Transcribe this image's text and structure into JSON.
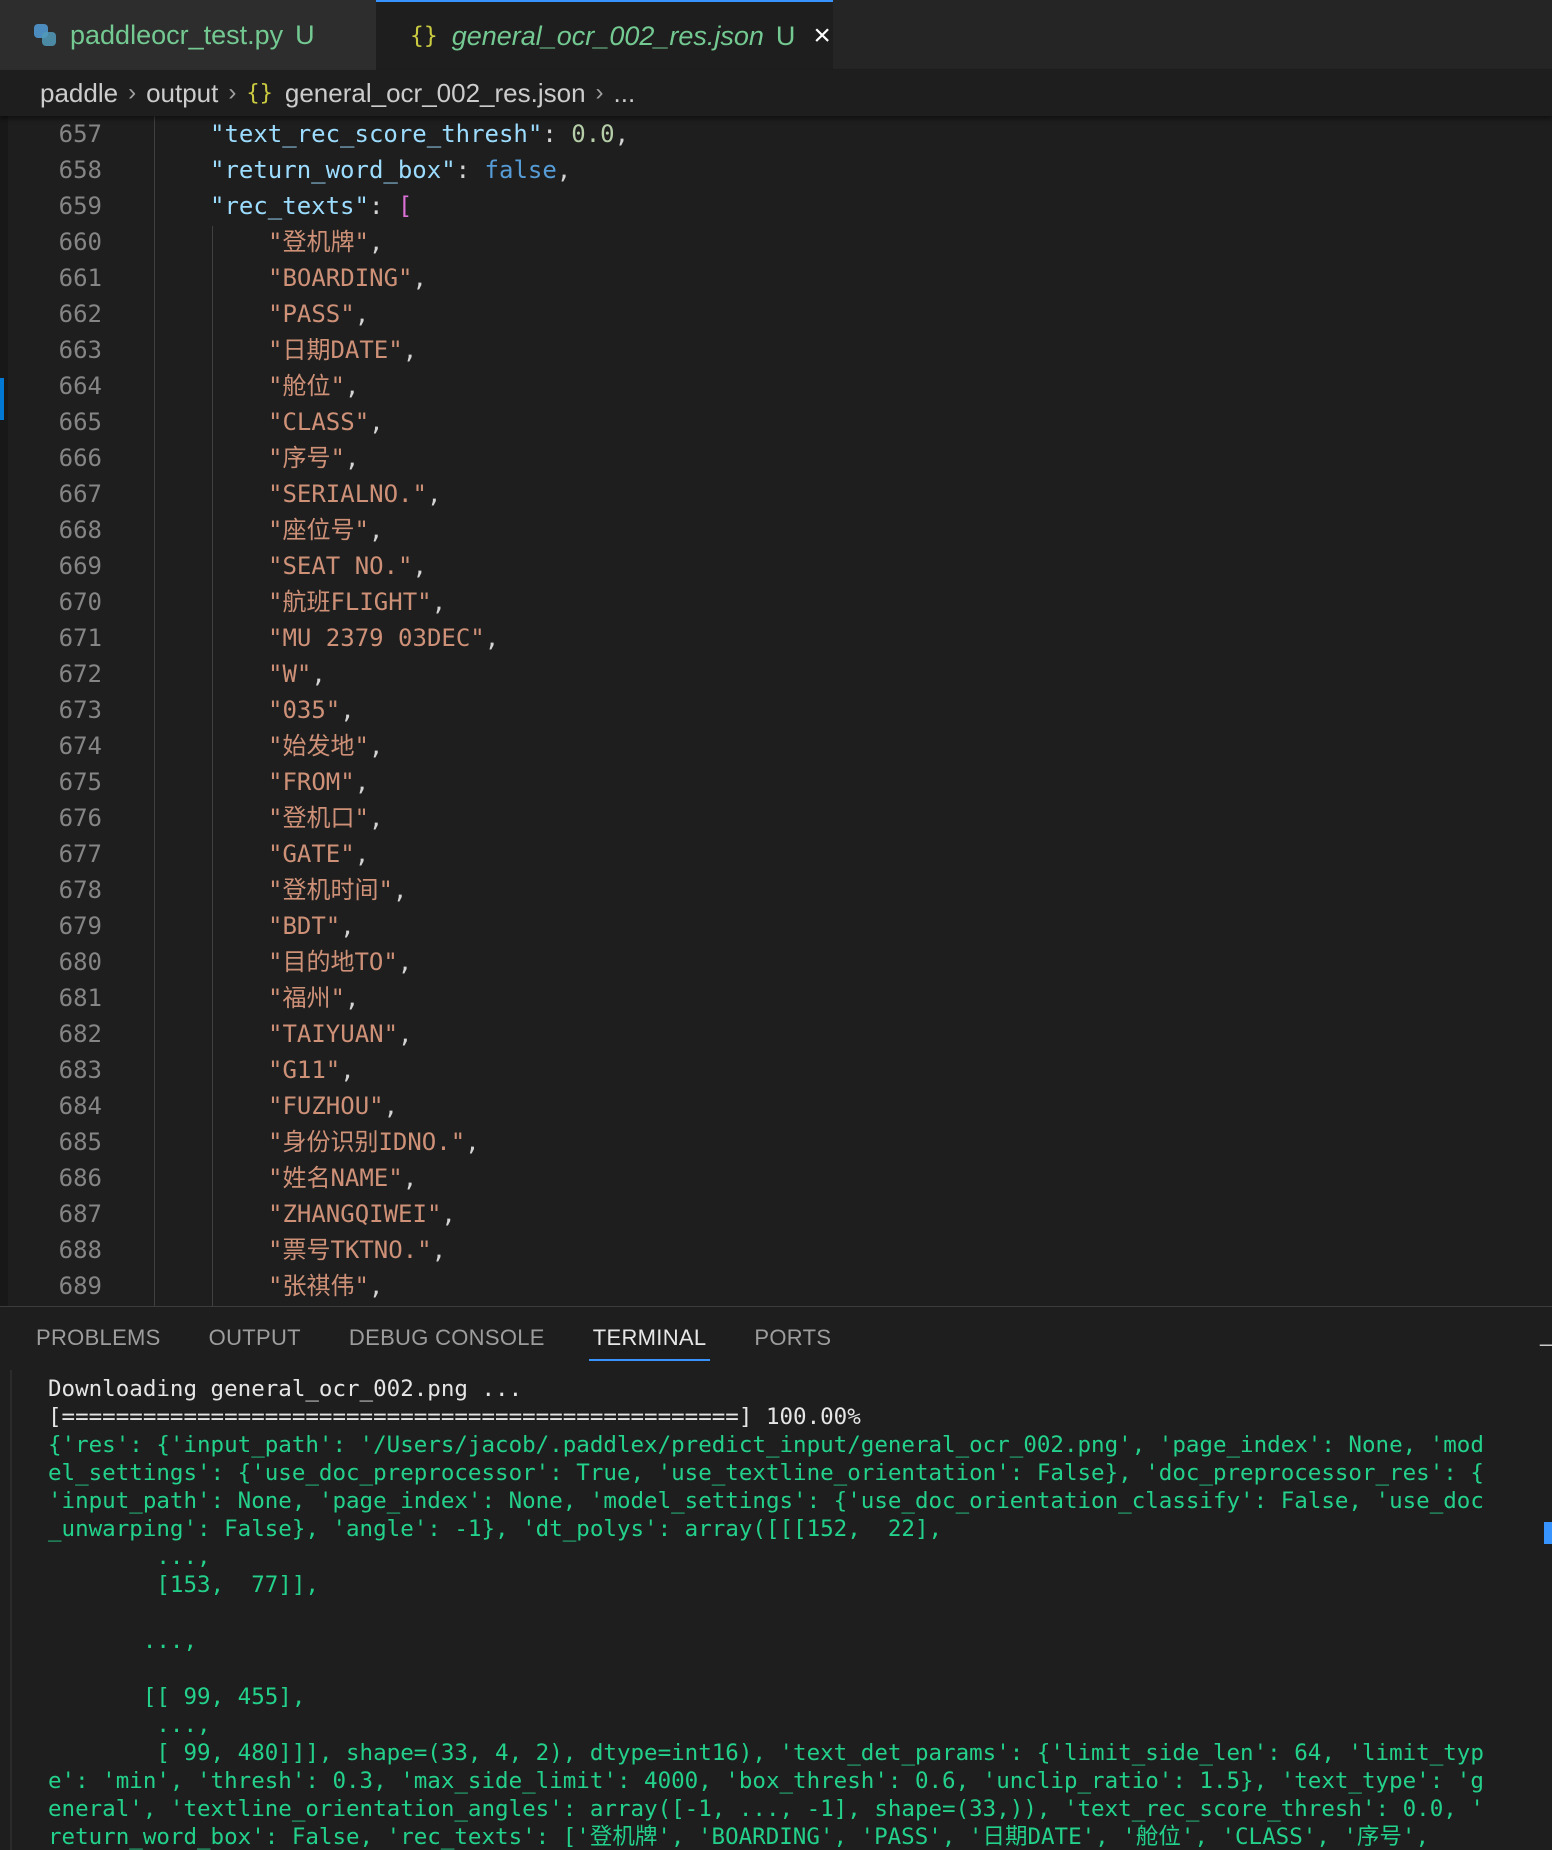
{
  "tabs": [
    {
      "label": "paddleocr_test.py",
      "status": "U",
      "icon": "python-file-icon",
      "active": false
    },
    {
      "label": "general_ocr_002_res.json",
      "status": "U",
      "icon": "json-file-icon",
      "active": true,
      "close": "×"
    }
  ],
  "breadcrumb": {
    "items": [
      "paddle",
      "output",
      "general_ocr_002_res.json",
      "..."
    ],
    "json_glyph": "{}",
    "separator": "›"
  },
  "editor": {
    "lines": [
      {
        "num": "657",
        "key": "\"text_rec_score_thresh\"",
        "colon": ": ",
        "value": "0.0",
        "vtype": "number",
        "tail": ","
      },
      {
        "num": "658",
        "key": "\"return_word_box\"",
        "colon": ": ",
        "value": "false",
        "vtype": "bool",
        "tail": ","
      },
      {
        "num": "659",
        "key": "\"rec_texts\"",
        "colon": ": ",
        "value": "[",
        "vtype": "bracket",
        "tail": ""
      },
      {
        "num": "660",
        "str": "\"登机牌\"",
        "tail": ","
      },
      {
        "num": "661",
        "str": "\"BOARDING\"",
        "tail": ","
      },
      {
        "num": "662",
        "str": "\"PASS\"",
        "tail": ","
      },
      {
        "num": "663",
        "str": "\"日期DATE\"",
        "tail": ","
      },
      {
        "num": "664",
        "str": "\"舱位\"",
        "tail": ","
      },
      {
        "num": "665",
        "str": "\"CLASS\"",
        "tail": ","
      },
      {
        "num": "666",
        "str": "\"序号\"",
        "tail": ","
      },
      {
        "num": "667",
        "str": "\"SERIALNO.\"",
        "tail": ","
      },
      {
        "num": "668",
        "str": "\"座位号\"",
        "tail": ","
      },
      {
        "num": "669",
        "str": "\"SEAT NO.\"",
        "tail": ","
      },
      {
        "num": "670",
        "str": "\"航班FLIGHT\"",
        "tail": ","
      },
      {
        "num": "671",
        "str": "\"MU 2379 03DEC\"",
        "tail": ","
      },
      {
        "num": "672",
        "str": "\"W\"",
        "tail": ","
      },
      {
        "num": "673",
        "str": "\"035\"",
        "tail": ","
      },
      {
        "num": "674",
        "str": "\"始发地\"",
        "tail": ","
      },
      {
        "num": "675",
        "str": "\"FROM\"",
        "tail": ","
      },
      {
        "num": "676",
        "str": "\"登机口\"",
        "tail": ","
      },
      {
        "num": "677",
        "str": "\"GATE\"",
        "tail": ","
      },
      {
        "num": "678",
        "str": "\"登机时间\"",
        "tail": ","
      },
      {
        "num": "679",
        "str": "\"BDT\"",
        "tail": ","
      },
      {
        "num": "680",
        "str": "\"目的地TO\"",
        "tail": ","
      },
      {
        "num": "681",
        "str": "\"福州\"",
        "tail": ","
      },
      {
        "num": "682",
        "str": "\"TAIYUAN\"",
        "tail": ","
      },
      {
        "num": "683",
        "str": "\"G11\"",
        "tail": ","
      },
      {
        "num": "684",
        "str": "\"FUZHOU\"",
        "tail": ","
      },
      {
        "num": "685",
        "str": "\"身份识别IDNO.\"",
        "tail": ","
      },
      {
        "num": "686",
        "str": "\"姓名NAME\"",
        "tail": ","
      },
      {
        "num": "687",
        "str": "\"ZHANGQIWEI\"",
        "tail": ","
      },
      {
        "num": "688",
        "str": "\"票号TKTNO.\"",
        "tail": ","
      },
      {
        "num": "689",
        "str": "\"张祺伟\"",
        "tail": ","
      }
    ]
  },
  "panel": {
    "tabs": [
      "PROBLEMS",
      "OUTPUT",
      "DEBUG CONSOLE",
      "TERMINAL",
      "PORTS"
    ],
    "active_tab": "TERMINAL",
    "more": "–"
  },
  "terminal": {
    "lines": [
      {
        "text": "Downloading general_ocr_002.png ...",
        "color": "white"
      },
      {
        "text": "[==================================================] 100.00%",
        "color": "white"
      },
      {
        "text": "{'res': {'input_path': '/Users/jacob/.paddlex/predict_input/general_ocr_002.png', 'page_index': None, 'mod",
        "color": "green"
      },
      {
        "text": "el_settings': {'use_doc_preprocessor': True, 'use_textline_orientation': False}, 'doc_preprocessor_res': {",
        "color": "green"
      },
      {
        "text": "'input_path': None, 'page_index': None, 'model_settings': {'use_doc_orientation_classify': False, 'use_doc",
        "color": "green"
      },
      {
        "text": "_unwarping': False}, 'angle': -1}, 'dt_polys': array([[[152,  22],",
        "color": "green"
      },
      {
        "text": "        ...,",
        "color": "green"
      },
      {
        "text": "        [153,  77]],",
        "color": "green"
      },
      {
        "text": "",
        "color": "green"
      },
      {
        "text": "       ...,",
        "color": "green"
      },
      {
        "text": "",
        "color": "green"
      },
      {
        "text": "       [[ 99, 455],",
        "color": "green"
      },
      {
        "text": "        ...,",
        "color": "green"
      },
      {
        "text": "        [ 99, 480]]], shape=(33, 4, 2), dtype=int16), 'text_det_params': {'limit_side_len': 64, 'limit_typ",
        "color": "green"
      },
      {
        "text": "e': 'min', 'thresh': 0.3, 'max_side_limit': 4000, 'box_thresh': 0.6, 'unclip_ratio': 1.5}, 'text_type': 'g",
        "color": "green"
      },
      {
        "text": "eneral', 'textline_orientation_angles': array([-1, ..., -1], shape=(33,)), 'text_rec_score_thresh': 0.0, '",
        "color": "green"
      },
      {
        "text": "return_word_box': False, 'rec_texts': ['登机牌', 'BOARDING', 'PASS', '日期DATE', '舱位', 'CLASS', '序号',",
        "color": "green"
      }
    ]
  }
}
